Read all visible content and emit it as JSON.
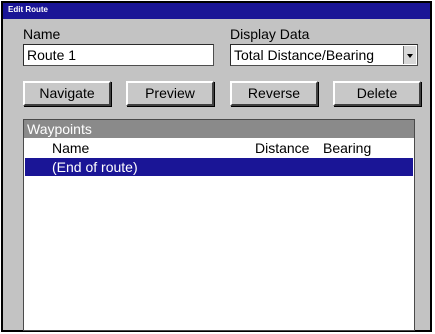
{
  "window": {
    "title": "Edit Route"
  },
  "name_field": {
    "label": "Name",
    "value": "Route 1"
  },
  "display_field": {
    "label": "Display Data",
    "selected": "Total Distance/Bearing"
  },
  "buttons": {
    "navigate": "Navigate",
    "preview": "Preview",
    "reverse": "Reverse",
    "delete": "Delete"
  },
  "waypoints": {
    "title": "Waypoints",
    "columns": {
      "name": "Name",
      "distance": "Distance",
      "bearing": "Bearing"
    },
    "rows": [
      {
        "name": "(End of route)",
        "distance": "",
        "bearing": "",
        "selected": true
      }
    ]
  },
  "colors": {
    "titlebar": "#1a1596",
    "selection": "#1a1596",
    "panel": "#c3c3c3",
    "group_header": "#8a8a8a"
  }
}
